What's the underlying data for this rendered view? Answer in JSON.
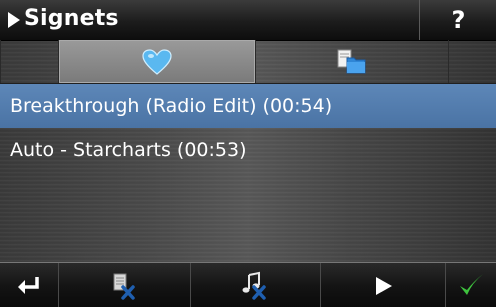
{
  "title": "Signets",
  "help_label": "?",
  "tabs": [
    {
      "icon": "heart-icon",
      "selected": true
    },
    {
      "icon": "folders-icon",
      "selected": false
    }
  ],
  "items": [
    {
      "label": "Breakthrough (Radio Edit)  (00:54)",
      "selected": true
    },
    {
      "label": "Auto - Starcharts  (00:53)",
      "selected": false
    }
  ],
  "toolbar": [
    {
      "icon": "back-arrow-icon"
    },
    {
      "icon": "delete-list-icon"
    },
    {
      "icon": "delete-music-icon"
    },
    {
      "icon": "play-icon"
    },
    {
      "icon": "checkmark-icon"
    }
  ],
  "colors": {
    "selection": "#5380b2",
    "heart": "#5ab8f0",
    "checkmark": "#3ec23e",
    "delete_x": "#1f5fb0"
  }
}
